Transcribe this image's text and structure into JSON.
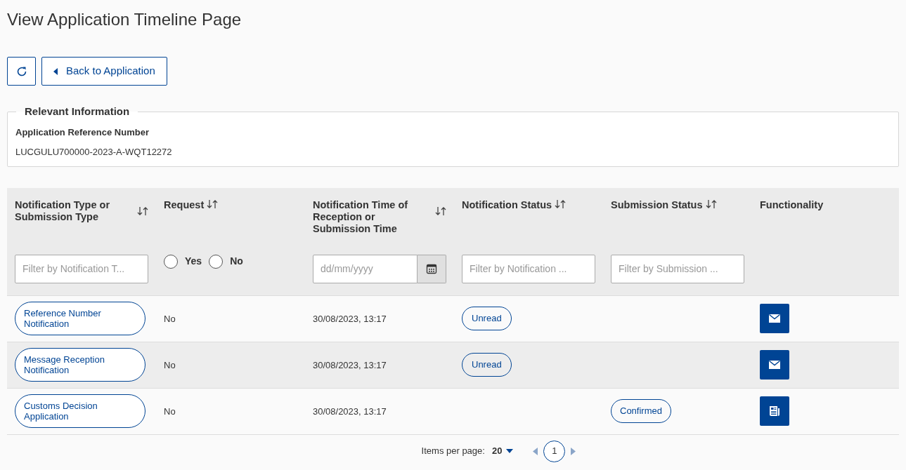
{
  "page_title": "View Application Timeline Page",
  "toolbar": {
    "back_button": "Back to Application"
  },
  "relevant_information": {
    "legend": "Relevant Information",
    "field_label": "Application Reference Number",
    "field_value": "LUCGULU700000-2023-A-WQT12272"
  },
  "table": {
    "columns": [
      {
        "label": "Notification Type or Submission Type",
        "sortable": true,
        "filter": {
          "kind": "text",
          "placeholder": "Filter by Notification T..."
        }
      },
      {
        "label": "Request",
        "sortable": true,
        "filter": {
          "kind": "radio",
          "options": [
            {
              "label": "Yes",
              "selected": false
            },
            {
              "label": "No",
              "selected": false
            }
          ]
        }
      },
      {
        "label": "Notification Time of Reception or Submission Time",
        "sortable": true,
        "filter": {
          "kind": "date",
          "placeholder": "dd/mm/yyyy"
        }
      },
      {
        "label": "Notification Status",
        "sortable": true,
        "filter": {
          "kind": "text",
          "placeholder": "Filter by Notification ..."
        }
      },
      {
        "label": "Submission Status",
        "sortable": true,
        "filter": {
          "kind": "text",
          "placeholder": "Filter by Submission ..."
        }
      },
      {
        "label": "Functionality",
        "sortable": false
      }
    ],
    "rows": [
      {
        "type": "Reference Number Notification",
        "request": "No",
        "time": "30/08/2023, 13:17",
        "notification_status": "Unread",
        "kind": "mail",
        "highlighted": false
      },
      {
        "type": "Message Reception Notification",
        "request": "No",
        "time": "30/08/2023, 13:17",
        "notification_status": "Unread",
        "kind": "mail",
        "highlighted": true
      },
      {
        "type": "Customs Decision Application",
        "request": "No",
        "time": "30/08/2023, 13:17",
        "submission_status": "Confirmed",
        "kind": "document",
        "highlighted": false
      }
    ]
  },
  "pagination": {
    "items_per_page_label": "Items per page:",
    "items_per_page": "20",
    "pages": [
      {
        "label": "1",
        "selected": true
      }
    ]
  }
}
